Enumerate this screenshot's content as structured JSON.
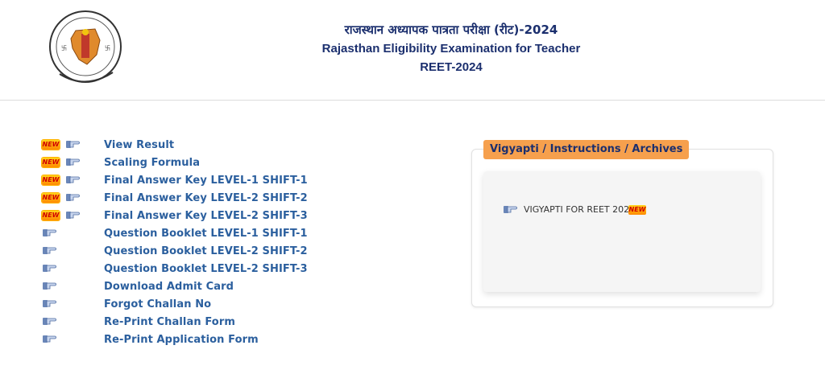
{
  "header": {
    "title_hindi": "राजस्थान अध्यापक पात्रता परीक्षा (रीट)-2024",
    "title_english": "Rajasthan Eligibility Examination for Teacher",
    "subtitle": "REET-2024",
    "logo_icon": "board-of-secondary-education-rajasthan-emblem"
  },
  "new_badge_label": "NEW",
  "links": [
    {
      "label": "View Result",
      "is_new": true
    },
    {
      "label": "Scaling Formula",
      "is_new": true
    },
    {
      "label": "Final Answer Key LEVEL-1 SHIFT-1",
      "is_new": true
    },
    {
      "label": "Final Answer Key LEVEL-2 SHIFT-2",
      "is_new": true
    },
    {
      "label": "Final Answer Key LEVEL-2 SHIFT-3",
      "is_new": true
    },
    {
      "label": "Question Booklet LEVEL-1 SHIFT-1",
      "is_new": false
    },
    {
      "label": "Question Booklet LEVEL-2 SHIFT-2",
      "is_new": false
    },
    {
      "label": "Question Booklet LEVEL-2 SHIFT-3",
      "is_new": false
    },
    {
      "label": "Download Admit Card",
      "is_new": false
    },
    {
      "label": "Forgot Challan No",
      "is_new": false
    },
    {
      "label": "Re-Print Challan Form",
      "is_new": false
    },
    {
      "label": "Re-Print Application Form",
      "is_new": false
    }
  ],
  "panel": {
    "title": "Vigyapti / Instructions / Archives",
    "items": [
      {
        "label": "VIGYAPTI FOR REET 2024",
        "is_new": true
      }
    ]
  },
  "colors": {
    "header_text": "#1b2f6e",
    "link_text": "#2b5f9e",
    "panel_title_bg": "#f6a04d",
    "new_badge_bg": "#ffb300",
    "new_badge_text": "#d00000"
  },
  "icons": {
    "link_pointer": "pointing-hand-icon",
    "new_badge": "new-badge-icon"
  }
}
